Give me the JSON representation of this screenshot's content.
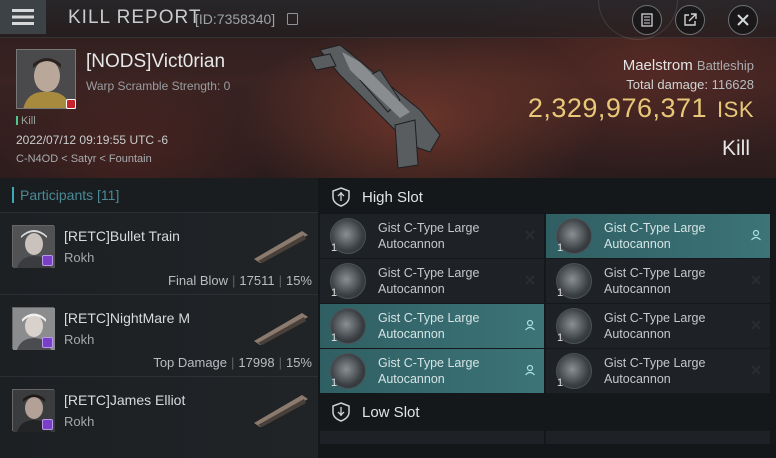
{
  "header": {
    "title": "KILL REPORT",
    "kill_id": "[ID:7358340]"
  },
  "victim": {
    "name": "[NODS]Vict0rian",
    "warp_scramble": "Warp Scramble Strength: 0",
    "tag": "Kill",
    "datetime": "2022/07/12 09:19:55 UTC -6",
    "location": "C-N4OD < Satyr < Fountain"
  },
  "ship": {
    "name": "Maelstrom",
    "class": "Battleship",
    "total_damage_label": "Total damage:",
    "total_damage": "116628",
    "isk_value": "2,329,976,371",
    "isk_unit": "ISK",
    "result": "Kill"
  },
  "participants": {
    "label": "Participants",
    "count": "[11]",
    "rows": [
      {
        "name": "[RETC]Bullet Train",
        "ship": "Rokh",
        "stat_label": "Final Blow",
        "damage": "17511",
        "percent": "15%"
      },
      {
        "name": "[RETC]NightMare M",
        "ship": "Rokh",
        "stat_label": "Top Damage",
        "damage": "17998",
        "percent": "15%"
      },
      {
        "name": "[RETC]James Elliot",
        "ship": "Rokh",
        "stat_label": "",
        "damage": "",
        "percent": ""
      }
    ]
  },
  "slots": {
    "high_slot_label": "High Slot",
    "low_slot_label": "Low Slot",
    "high": [
      {
        "name": "Gist C-Type Large Autocannon",
        "qty": "1",
        "state": "destroyed"
      },
      {
        "name": "Gist C-Type Large Autocannon",
        "qty": "1",
        "state": "dropped"
      },
      {
        "name": "Gist C-Type Large Autocannon",
        "qty": "1",
        "state": "destroyed"
      },
      {
        "name": "Gist C-Type Large Autocannon",
        "qty": "1",
        "state": "destroyed"
      },
      {
        "name": "Gist C-Type Large Autocannon",
        "qty": "1",
        "state": "dropped"
      },
      {
        "name": "Gist C-Type Large Autocannon",
        "qty": "1",
        "state": "destroyed"
      },
      {
        "name": "Gist C-Type Large Autocannon",
        "qty": "1",
        "state": "dropped"
      },
      {
        "name": "Gist C-Type Large Autocannon",
        "qty": "1",
        "state": "destroyed"
      }
    ]
  },
  "colors": {
    "accent": "#3fa7b7",
    "isk": "#e8c878",
    "dropped": "#3c7478"
  }
}
